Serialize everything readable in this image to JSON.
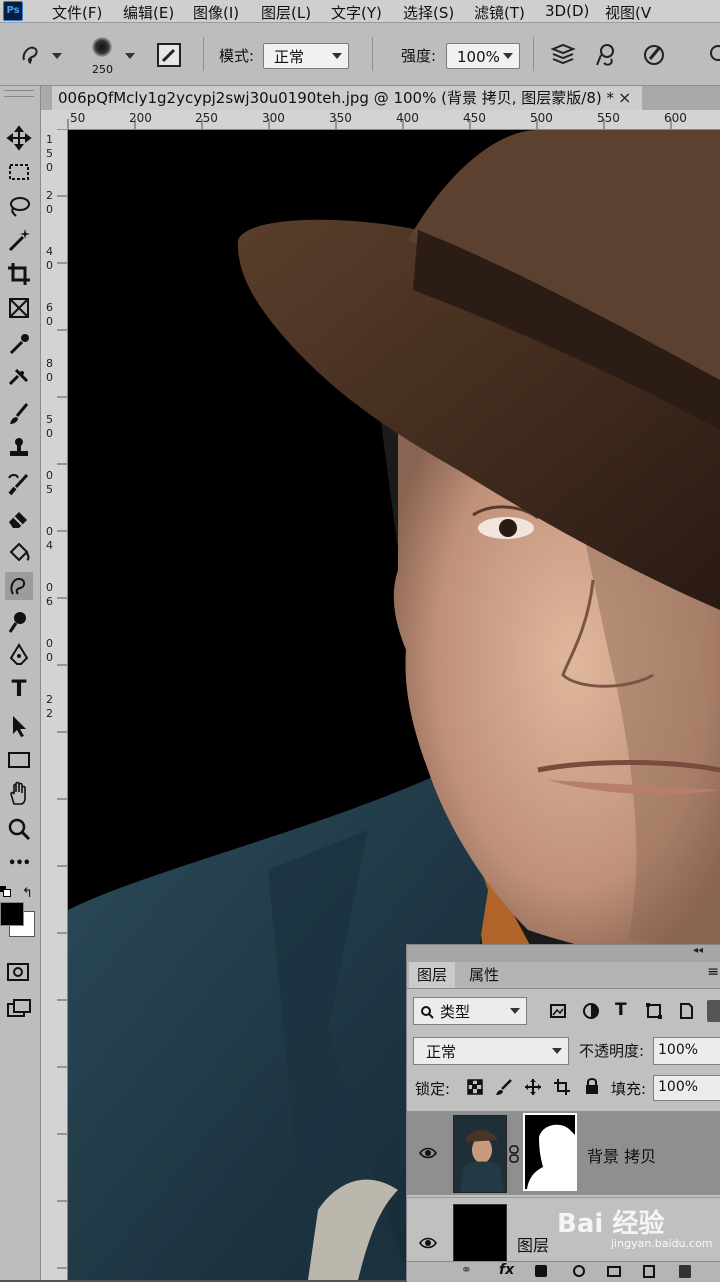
{
  "app": {
    "logo": "Ps"
  },
  "menu": [
    "文件(F)",
    "编辑(E)",
    "图像(I)",
    "图层(L)",
    "文字(Y)",
    "选择(S)",
    "滤镜(T)",
    "3D(D)",
    "视图(V"
  ],
  "options": {
    "brush_size": "250",
    "mode_label": "模式:",
    "mode_value": "正常",
    "strength_label": "强度:",
    "strength_value": "100%"
  },
  "document": {
    "tab_title": "006pQfMcly1g2ycypj2swj30u0190teh.jpg @ 100% (背景 拷贝, 图层蒙版/8) *",
    "close_glyph": "×"
  },
  "ruler_top": [
    "50",
    "200",
    "250",
    "300",
    "350",
    "400",
    "450",
    "500",
    "550",
    "600"
  ],
  "ruler_left": [
    "1",
    "5",
    "0",
    "2",
    "0",
    "4",
    "0",
    "6",
    "0",
    "8",
    "0",
    "5",
    "0",
    "0",
    "5",
    "0",
    "4",
    "0",
    "6",
    "0",
    "0",
    "2",
    "2"
  ],
  "toolbar": {
    "tools": [
      "move-tool-icon",
      "marquee-tool-icon",
      "lasso-tool-icon",
      "magic-wand-icon",
      "crop-tool-icon",
      "frame-tool-icon",
      "eyedropper-icon",
      "healing-brush-icon",
      "brush-tool-icon",
      "clone-stamp-icon",
      "history-brush-icon",
      "eraser-icon",
      "paint-bucket-icon",
      "smudge-tool-icon",
      "dodge-tool-icon",
      "pen-tool-icon",
      "type-tool-icon",
      "path-selection-icon",
      "rectangle-tool-icon",
      "hand-tool-icon",
      "zoom-tool-icon",
      "more-tools-icon"
    ],
    "text_tool_glyph": "T",
    "more_glyph": "•••"
  },
  "layers_panel": {
    "tabs": [
      "图层",
      "属性"
    ],
    "filter_label": "类型",
    "blend_mode": "正常",
    "opacity_label": "不透明度:",
    "opacity_value": "100%",
    "lock_label": "锁定:",
    "fill_label": "填充:",
    "fill_value": "100%",
    "layers": [
      {
        "name": "背景 拷贝",
        "selected": true
      },
      {
        "name": "图层",
        "selected": false
      }
    ],
    "footer_fx": "fx"
  },
  "watermark": {
    "brand": "Bai 经验",
    "url": "jingyan.baidu.com"
  },
  "colors": {
    "canvas_bg": "#000000",
    "hat": "#4a3424",
    "jacket": "#1f3a47",
    "skin": "#c79a7e",
    "panel": "#c0c0c0"
  }
}
